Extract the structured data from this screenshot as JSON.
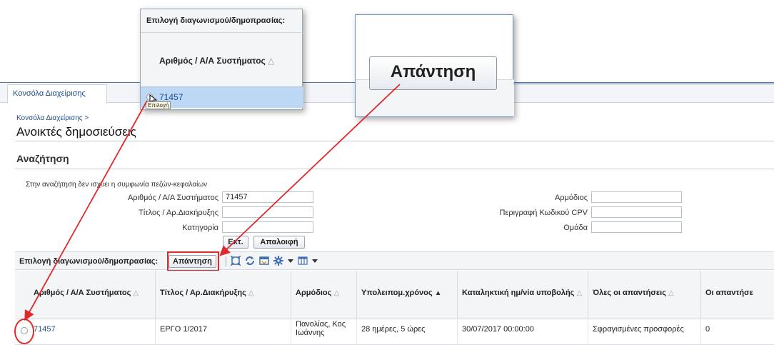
{
  "tabs": [
    {
      "label": "Κονσόλα Διαχείρισης"
    }
  ],
  "breadcrumb": "Κονσόλα Διαχείρισης >",
  "page_title": "Ανοικτές δημοσιεύσεις",
  "search": {
    "title": "Αναζήτηση",
    "note": "Στην αναζήτηση δεν ισχύει η συμφωνία πεζών-κεφαλαίων",
    "fields": {
      "system_no": {
        "label": "Αριθμός / Α/Α Συστήματος",
        "value": "71457"
      },
      "title": {
        "label": "Τίτλος / Αρ.Διακήρυξης",
        "value": ""
      },
      "category": {
        "label": "Κατηγορία",
        "value": ""
      },
      "responsible": {
        "label": "Αρμόδιος",
        "value": ""
      },
      "cpv": {
        "label": "Περιγραφή Κωδικού CPV",
        "value": ""
      },
      "group": {
        "label": "Ομάδα",
        "value": ""
      }
    },
    "execute_label": "Εκτ.",
    "clear_label": "Απαλοιφή"
  },
  "toolbar": {
    "label": "Επιλογή διαγωνισμού/δημοπρασίας:",
    "reply_label": "Απάντηση"
  },
  "table": {
    "columns": [
      {
        "label": "Αριθμός / Α/Α Συστήματος"
      },
      {
        "label": "Τίτλος / Αρ.Διακήρυξης"
      },
      {
        "label": "Αρμόδιος"
      },
      {
        "label": "Υπολειπομ.χρόνος"
      },
      {
        "label": "Καταληκτική ημ/νία υποβολής"
      },
      {
        "label": "Όλες οι απαντήσεις"
      },
      {
        "label": "Οι απαντήσε"
      }
    ],
    "rows": [
      {
        "system_no": "71457",
        "title": "ΕΡΓΟ 1/2017",
        "responsible": "Πανολίας, Κος Ιωάννης",
        "remaining": "28 ημέρες, 5 ώρες",
        "deadline": "30/07/2017 00:00:00",
        "all_replies": "Σφραγισμένες προσφορές",
        "replies": "0"
      }
    ]
  },
  "callout_select": {
    "label": "Επιλογή διαγωνισμού/δημοπρασίας:",
    "column": "Αριθμός / Α/Α Συστήματος",
    "value": "71457",
    "tooltip": "Επιλογή"
  },
  "callout_button": {
    "label": "Απάντηση"
  },
  "colors": {
    "accent": "#1f4e8c",
    "highlight": "#e02a2a",
    "selected_row": "#bcd8f4"
  }
}
